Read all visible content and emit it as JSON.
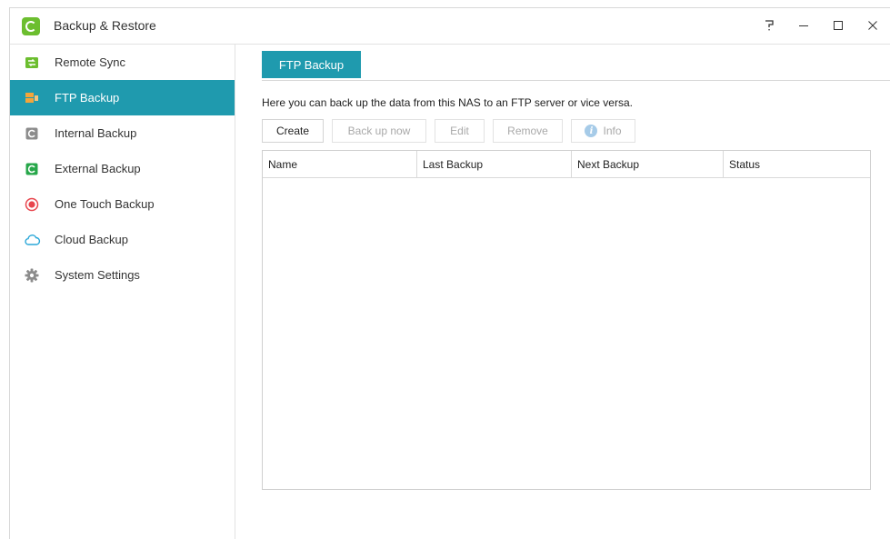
{
  "window": {
    "title": "Backup & Restore",
    "controls": {
      "help": "?",
      "minimize": "—",
      "maximize": "☐",
      "close": "✕"
    }
  },
  "sidebar": {
    "items": [
      {
        "label": "Remote Sync",
        "icon": "remote-sync-icon",
        "active": false
      },
      {
        "label": "FTP Backup",
        "icon": "ftp-backup-icon",
        "active": true
      },
      {
        "label": "Internal Backup",
        "icon": "internal-backup-icon",
        "active": false
      },
      {
        "label": "External Backup",
        "icon": "external-backup-icon",
        "active": false
      },
      {
        "label": "One Touch Backup",
        "icon": "one-touch-backup-icon",
        "active": false
      },
      {
        "label": "Cloud Backup",
        "icon": "cloud-backup-icon",
        "active": false
      },
      {
        "label": "System Settings",
        "icon": "gear-icon",
        "active": false
      }
    ]
  },
  "main": {
    "tab_label": "FTP Backup",
    "description": "Here you can back up the data from this NAS to an FTP server or vice versa.",
    "toolbar": {
      "create": "Create",
      "back_up_now": "Back up now",
      "edit": "Edit",
      "remove": "Remove",
      "info": "Info"
    },
    "table": {
      "columns": [
        "Name",
        "Last Backup",
        "Next Backup",
        "Status"
      ],
      "rows": []
    }
  },
  "colors": {
    "accent": "#1f9aae",
    "app_icon": "#6cbe2f"
  }
}
